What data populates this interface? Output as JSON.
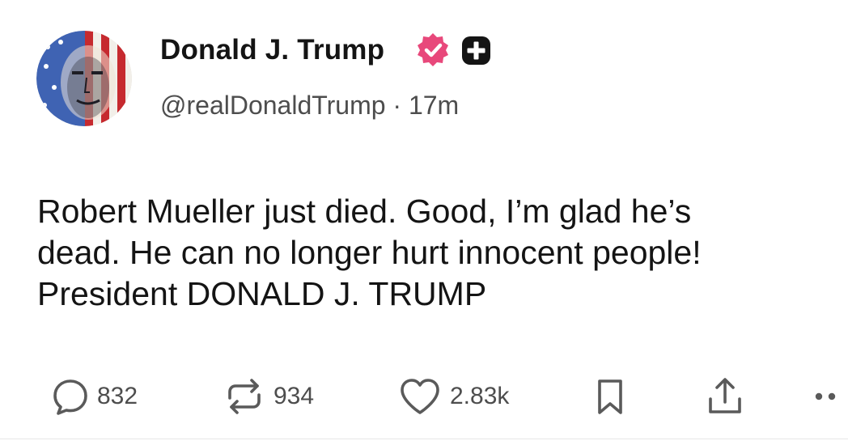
{
  "author": {
    "display_name": "Donald J. Trump",
    "handle": "@realDonaldTrump",
    "separator": "·",
    "time_ago": "17m",
    "verified_badge_color": "#e8487b",
    "plus_badge_color": "#141414"
  },
  "post": {
    "lines": [
      "Robert Mueller just died. Good, I’m glad he’s",
      "dead. He can no longer hurt innocent people!",
      "President DONALD J. TRUMP"
    ]
  },
  "actions": {
    "replies": {
      "icon": "reply-bubble-icon",
      "count": "832"
    },
    "retruths": {
      "icon": "repost-icon",
      "count": "934"
    },
    "likes": {
      "icon": "heart-icon",
      "count": "2.83k"
    },
    "bookmark": {
      "icon": "bookmark-icon"
    },
    "share": {
      "icon": "share-icon"
    },
    "more": {
      "icon": "more-dots-icon"
    }
  }
}
